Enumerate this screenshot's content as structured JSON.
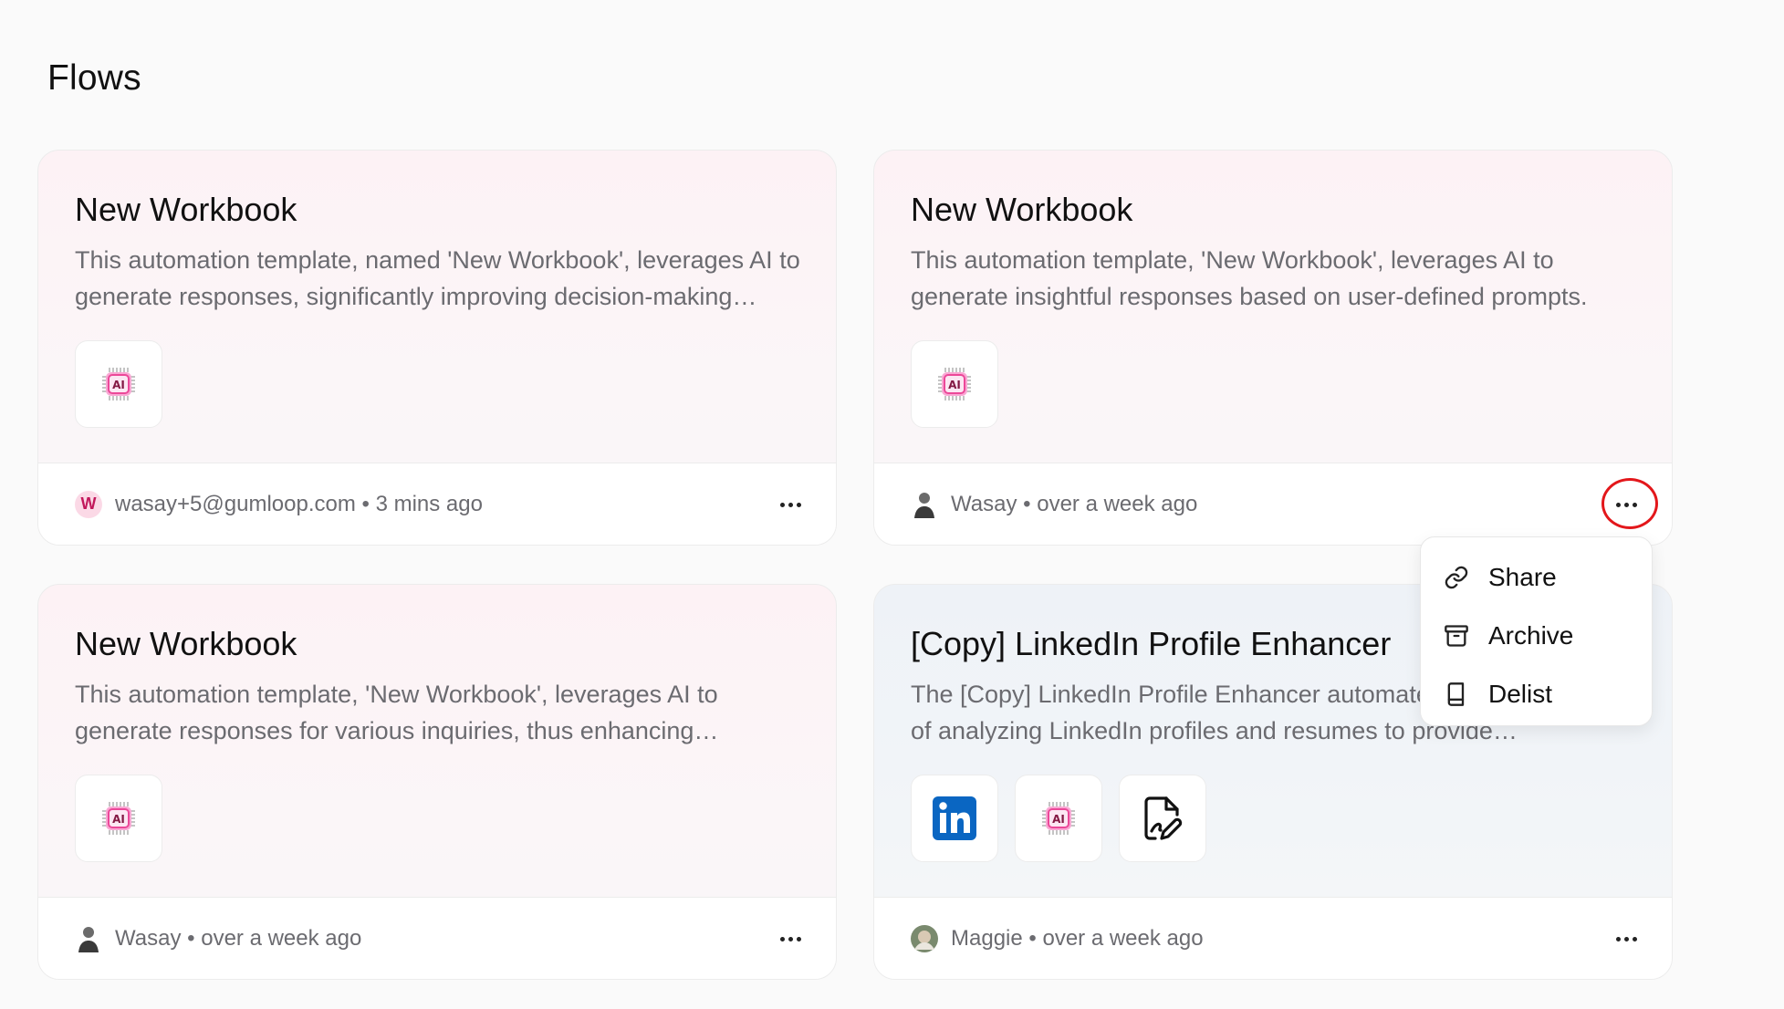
{
  "page": {
    "title": "Flows"
  },
  "cards": [
    {
      "title": "New Workbook",
      "description": "This automation template, named 'New Workbook', leverages AI to generate responses, significantly improving decision-making processes.",
      "icons": [
        "ai-chip-icon"
      ],
      "author": "wasay+5@gumloop.com",
      "avatar_letter": "W",
      "time": "3 mins ago"
    },
    {
      "title": "New Workbook",
      "description": "This automation template, 'New Workbook', leverages AI to generate insightful responses based on user-defined prompts.",
      "icons": [
        "ai-chip-icon"
      ],
      "author": "Wasay",
      "time": "over a week ago"
    },
    {
      "title": "New Workbook",
      "description": "This automation template, 'New Workbook', leverages AI to generate responses for various inquiries, thus enhancing productivity.",
      "icons": [
        "ai-chip-icon"
      ],
      "author": "Wasay",
      "time": "over a week ago"
    },
    {
      "title": "[Copy] LinkedIn Profile Enhancer",
      "description": "The [Copy] LinkedIn Profile Enhancer automates the process of analyzing LinkedIn profiles and resumes to provide insights.",
      "icons": [
        "linkedin-icon",
        "ai-chip-icon",
        "file-signature-icon"
      ],
      "author": "Maggie",
      "time": "over a week ago"
    }
  ],
  "separator": " • ",
  "menu": {
    "items": [
      {
        "label": "Share",
        "icon": "link-icon"
      },
      {
        "label": "Archive",
        "icon": "archive-icon"
      },
      {
        "label": "Delist",
        "icon": "book-icon"
      }
    ]
  },
  "colors": {
    "ai_pink": "#ec4899",
    "linkedin_blue": "#0a66c2",
    "highlight_red": "#e3171b"
  }
}
